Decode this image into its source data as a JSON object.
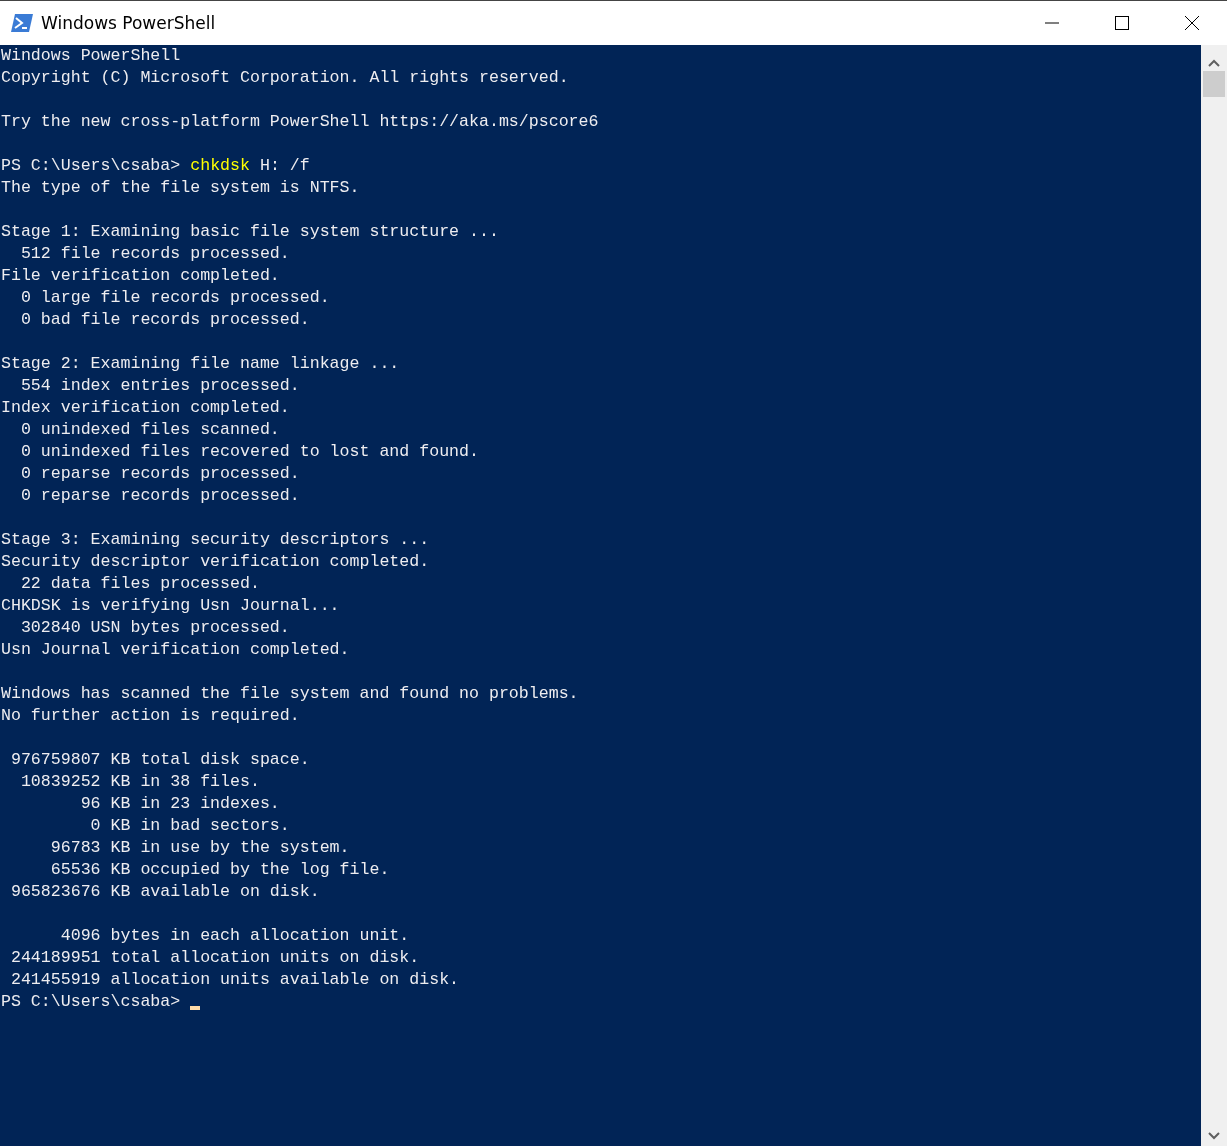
{
  "window": {
    "title": "Windows PowerShell"
  },
  "console": {
    "lines": [
      {
        "kind": "output",
        "text": "Windows PowerShell"
      },
      {
        "kind": "output",
        "text": "Copyright (C) Microsoft Corporation. All rights reserved."
      },
      {
        "kind": "blank"
      },
      {
        "kind": "output",
        "text": "Try the new cross-platform PowerShell https://aka.ms/pscore6"
      },
      {
        "kind": "blank"
      },
      {
        "kind": "command",
        "prompt": "PS C:\\Users\\csaba>",
        "command": "chkdsk",
        "args": "H: /f"
      },
      {
        "kind": "output",
        "text": "The type of the file system is NTFS."
      },
      {
        "kind": "blank"
      },
      {
        "kind": "output",
        "text": "Stage 1: Examining basic file system structure ..."
      },
      {
        "kind": "output",
        "text": "  512 file records processed."
      },
      {
        "kind": "output",
        "text": "File verification completed."
      },
      {
        "kind": "output",
        "text": "  0 large file records processed."
      },
      {
        "kind": "output",
        "text": "  0 bad file records processed."
      },
      {
        "kind": "blank"
      },
      {
        "kind": "output",
        "text": "Stage 2: Examining file name linkage ..."
      },
      {
        "kind": "output",
        "text": "  554 index entries processed."
      },
      {
        "kind": "output",
        "text": "Index verification completed."
      },
      {
        "kind": "output",
        "text": "  0 unindexed files scanned."
      },
      {
        "kind": "output",
        "text": "  0 unindexed files recovered to lost and found."
      },
      {
        "kind": "output",
        "text": "  0 reparse records processed."
      },
      {
        "kind": "output",
        "text": "  0 reparse records processed."
      },
      {
        "kind": "blank"
      },
      {
        "kind": "output",
        "text": "Stage 3: Examining security descriptors ..."
      },
      {
        "kind": "output",
        "text": "Security descriptor verification completed."
      },
      {
        "kind": "output",
        "text": "  22 data files processed."
      },
      {
        "kind": "output",
        "text": "CHKDSK is verifying Usn Journal..."
      },
      {
        "kind": "output",
        "text": "  302840 USN bytes processed."
      },
      {
        "kind": "output",
        "text": "Usn Journal verification completed."
      },
      {
        "kind": "blank"
      },
      {
        "kind": "output",
        "text": "Windows has scanned the file system and found no problems."
      },
      {
        "kind": "output",
        "text": "No further action is required."
      },
      {
        "kind": "blank"
      },
      {
        "kind": "output",
        "text": " 976759807 KB total disk space."
      },
      {
        "kind": "output",
        "text": "  10839252 KB in 38 files."
      },
      {
        "kind": "output",
        "text": "        96 KB in 23 indexes."
      },
      {
        "kind": "output",
        "text": "         0 KB in bad sectors."
      },
      {
        "kind": "output",
        "text": "     96783 KB in use by the system."
      },
      {
        "kind": "output",
        "text": "     65536 KB occupied by the log file."
      },
      {
        "kind": "output",
        "text": " 965823676 KB available on disk."
      },
      {
        "kind": "blank"
      },
      {
        "kind": "output",
        "text": "      4096 bytes in each allocation unit."
      },
      {
        "kind": "output",
        "text": " 244189951 total allocation units on disk."
      },
      {
        "kind": "output",
        "text": " 241455919 allocation units available on disk."
      },
      {
        "kind": "prompt",
        "prompt": "PS C:\\Users\\csaba>"
      }
    ]
  }
}
